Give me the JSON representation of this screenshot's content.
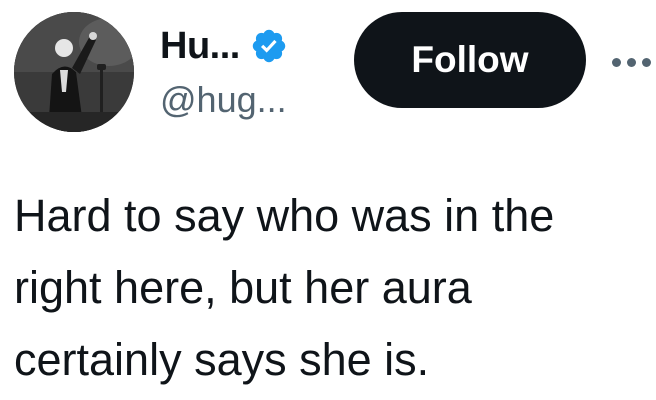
{
  "author": {
    "display_name": "Hu...",
    "handle": "@hug...",
    "verified": true,
    "avatar_icon": "avatar-photo"
  },
  "actions": {
    "follow_label": "Follow",
    "more_icon": "more-options-icon"
  },
  "tweet": {
    "text": "Hard to say who was in the\nright here, but her aura\ncertainly says she is."
  },
  "colors": {
    "text_primary": "#0f1419",
    "text_secondary": "#536471",
    "verified_blue": "#1d9bf0",
    "button_bg": "#0f1419",
    "button_text": "#ffffff",
    "background": "#ffffff"
  }
}
